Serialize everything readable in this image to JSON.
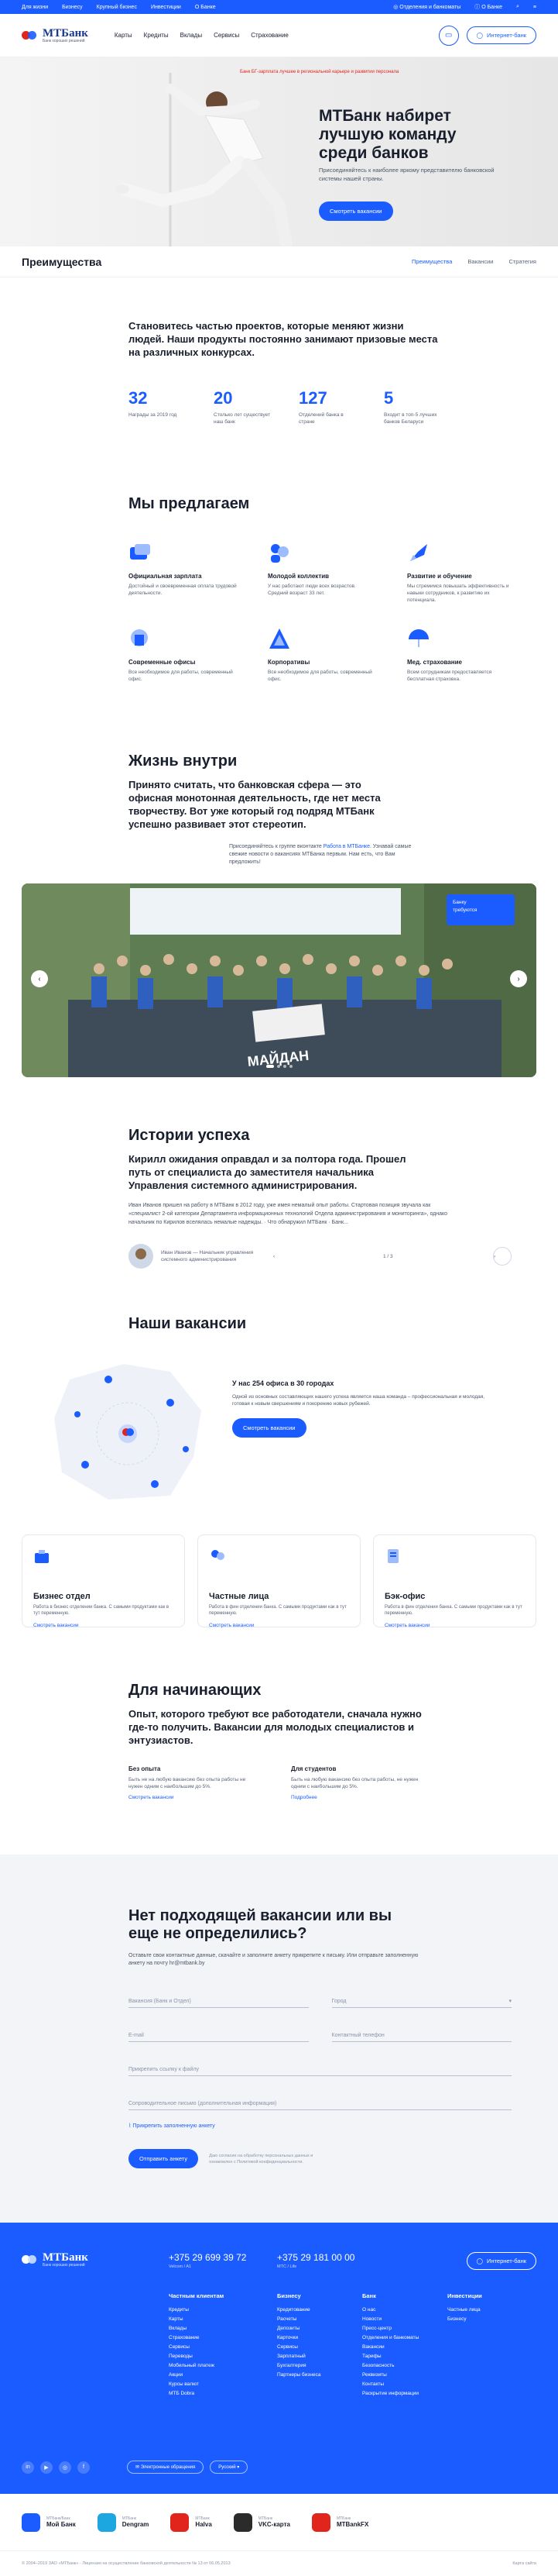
{
  "topbar": {
    "links": [
      "Для жизни",
      "Бизнесу",
      "Крупный бизнес",
      "Инвестиции",
      "О Банке"
    ],
    "offices": "Отделения и банкоматы",
    "about": "О Банке"
  },
  "header": {
    "logo": "МТБанк",
    "logo_tag": "Банк хороших решений",
    "nav": [
      "Карты",
      "Кредиты",
      "Вклады",
      "Сервисы",
      "Страхование"
    ],
    "inet_btn": "Интернет-банк"
  },
  "hero": {
    "notice": "Банк БГ-зарплата лучшее в региональной карьере и развитии персонала",
    "title": "МТБанк набирет лучшую команду среди банков",
    "text": "Присоединяйтесь к наиболее яркому представителю банковской системы нашей страны.",
    "cta": "Смотреть вакансии"
  },
  "tabs": {
    "title": "Преимущества",
    "items": [
      "Преимущества",
      "Вакансии",
      "Стратегия"
    ]
  },
  "intro": {
    "lead": "Становитесь частью проектов, которые меняют жизни людей. Наши продукты постоянно занимают призовые места на различных конкурсах.",
    "stats": [
      {
        "value": "32",
        "label": "Награды за 2019 год"
      },
      {
        "value": "20",
        "label": "Столько лет существует наш банк"
      },
      {
        "value": "127",
        "label": "Отделений банка в стране"
      },
      {
        "value": "5",
        "label": "Входит в топ-5 лучших банков Беларуси"
      }
    ]
  },
  "offer": {
    "title": "Мы предлагаем",
    "items": [
      {
        "title": "Официальная зарплата",
        "text": "Достойный и своевременная оплата трудовой деятельности."
      },
      {
        "title": "Молодой коллектив",
        "text": "У нас работают люди всех возрастов. Средний возраст 33 лет."
      },
      {
        "title": "Развитие и обучение",
        "text": "Мы стремимся повышать эффективность и навыки сотрудников, к развитию их потенциала."
      },
      {
        "title": "Современные офисы",
        "text": "Все необходимое для работы, современный офис."
      },
      {
        "title": "Корпоративы",
        "text": "Все необходимое для работы, современный офис."
      },
      {
        "title": "Мед. страхование",
        "text": "Всем сотрудникам предоставляется бесплатная страховка."
      }
    ]
  },
  "life": {
    "title": "Жизнь внутри",
    "lead": "Принято считать, что банковская сфера — это офисная монотонная деятельность, где нет места творчеству. Вот уже который год подряд МТБанк успешно развивает этот стереотип.",
    "text_pre": "Присоединяйтесь к группе вконтакте ",
    "text_link": "Работа в МТБанке",
    "text_post": ". Узнавай самые свежие новости о вакансиях МТБанка первым. Нам есть, что Вам предложить!",
    "vac_box_1": "Банку",
    "vac_box_2": "требуются",
    "banner": "МАЙДАН"
  },
  "story": {
    "title": "Истории успеха",
    "lead": "Кирилл ожидания оправдал и за полтора года. Прошел путь от специалиста до заместителя начальника Управления системного администрирования.",
    "text": "Иван Иванов пришел на работу в МТБанк в 2012 году, уже имея немалый опыт работы. Стартовая позиция звучала как «специалист 2-ой категории Департамента информационных технологий Отдела администрирования и мониторинга», однако начальник по Кирилов вселялась немалые надежды. · Что обнаружил МТБанк · Банк...",
    "author": "Иван Иванов — Начальник управления системного администрирования",
    "counter": "1 / 3"
  },
  "vac": {
    "title": "Наши вакансии",
    "sub": "У нас 254 офиса в 30 городах",
    "text": "Одной из основных составляющих нашего успеха является наша команда – профессиональная и молодая, готовая к новым свершениям и покорению новых рубежей.",
    "cta": "Смотреть вакансии",
    "cards": [
      {
        "title": "Бизнес отдел",
        "text": "Работа в бизнес отделении банка. С самыми продуктами как в тут переменную.",
        "link": "Смотреть вакансии"
      },
      {
        "title": "Частные лица",
        "text": "Работа в фин отделении банка. С самыми продуктами как в тут переменную.",
        "link": "Смотреть вакансии"
      },
      {
        "title": "Бэк-офис",
        "text": "Работа в фин отделении банка. С самыми продуктами как в тут переменную.",
        "link": "Смотреть вакансии"
      }
    ]
  },
  "beginners": {
    "title": "Для начинающих",
    "lead": "Опыт, которого требуют все работодатели, сначала нужно где-то получить. Вакансии для молодых специалистов и энтузиастов.",
    "cols": [
      {
        "title": "Без опыта",
        "text": "Быть не на любую вакансию без опыта работы не нужен одним с наибольшим до 5%.",
        "link": "Смотреть вакансии"
      },
      {
        "title": "Для студентов",
        "text": "Быть на любую вакансию без опыта работы, не нужен одним с наибольшим до 5%.",
        "link": "Подробнее"
      }
    ]
  },
  "form": {
    "title": "Нет подходящей вакансии или вы еще не определились?",
    "text": "Оставьте свои контактные данные, скачайте и заполните анкету прикрепите к письму. Или отправьте заполненную анкету на почту hr@mtbank.by",
    "f_vac": "Вакансия (Банк и Отдел)",
    "f_city": "Город",
    "f_email": "E-mail",
    "f_phone": "Контактный телефон",
    "f_link": "Прикрепить ссылку к файлу",
    "f_comment": "Сопроводительное письмо (дополнительная информация)",
    "attach": "Прикрепить заполненную анкету",
    "submit": "Отправить анкету",
    "consent": "Даю согласие на обработку персональных данных и ознакомлен с Политикой конфиденциальности."
  },
  "footer": {
    "phone1": "+375 29 699 39 72",
    "phone1_sub": "Velcom / A1",
    "phone2": "+375 29 181 00 00",
    "phone2_sub": "МТС / Life",
    "inet_btn": "Интернет-банк",
    "cols": [
      {
        "title": "Частным клиентам",
        "items": [
          "Кредиты",
          "Карты",
          "Вклады",
          "Страхование",
          "Сервисы",
          "Переводы",
          "Мобильный платеж",
          "Акции",
          "Курсы валют",
          "МТБ Dobra"
        ]
      },
      {
        "title": "Бизнесу",
        "items": [
          "Кредитование",
          "Расчеты",
          "Депозиты",
          "Карточки",
          "Сервисы",
          "Зарплатный",
          "Бухгалтерия",
          "Партнеры бизнеса"
        ]
      },
      {
        "title": "Банк",
        "items": [
          "О нас",
          "Новости",
          "Пресс-центр",
          "Отделения и банкоматы",
          "Вакансии",
          "Тарифы",
          "Безопасность",
          "Реквизиты",
          "Контакты",
          "Раскрытие информации"
        ]
      },
      {
        "title": "Инвестиции",
        "items": [
          "Частные лица",
          "Бизнесу"
        ]
      }
    ],
    "appeal": "Электронные обращения",
    "lang": "Русский"
  },
  "apps": [
    {
      "sub": "МТБанк/Банк",
      "name": "Мой Банк",
      "color": "#1a5cff"
    },
    {
      "sub": "МТБанк",
      "name": "Dengram",
      "color": "#1ca7e0"
    },
    {
      "sub": "МТБанк",
      "name": "Halva",
      "color": "#e1241c"
    },
    {
      "sub": "МТБанк",
      "name": "VKC-карта",
      "color": "#2b2b2b"
    },
    {
      "sub": "МТБанк",
      "name": "MTBankFX",
      "color": "#e1241c"
    }
  ],
  "legal": {
    "text": "© 2004–2019 ЗАО «МТБанк» · Лицензия на осуществление банковской деятельности № 13 от 06.05.2013",
    "sitemap": "Карта сайта"
  }
}
